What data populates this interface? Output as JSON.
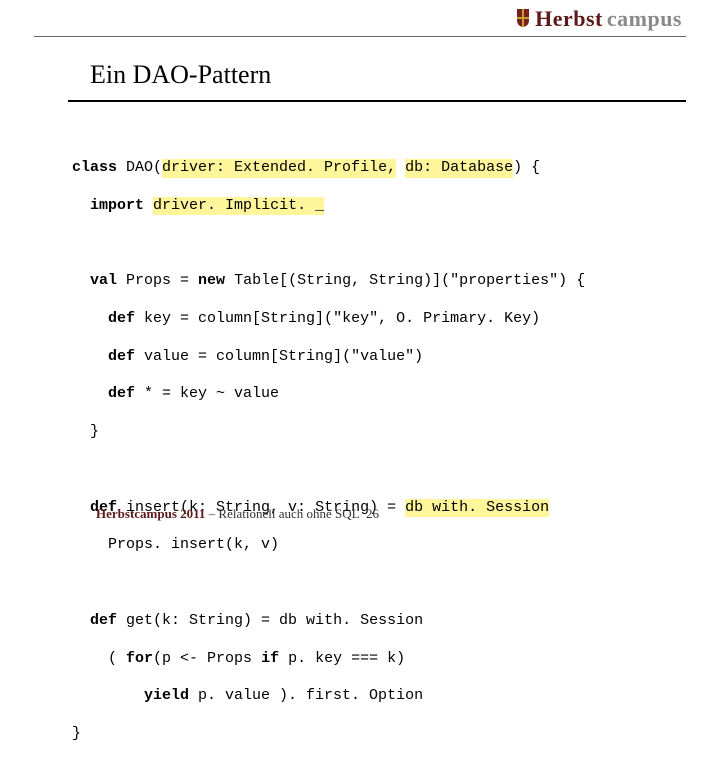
{
  "logo": {
    "part1": "Herbst",
    "part2": "campus"
  },
  "title": "Ein DAO-Pattern",
  "code": {
    "l1_a": "class",
    "l1_b": " DAO(",
    "l1_hl1": "driver: Extended. Profile,",
    "l1_mid": " ",
    "l1_hl2": "db: Database",
    "l1_c": ") {",
    "l2_a": "  ",
    "l2_kw": "import",
    "l2_sp": " ",
    "l2_hl": "driver. Implicit. _",
    "l4_a": "  ",
    "l4_kw1": "val",
    "l4_b": " Props = ",
    "l4_kw2": "new",
    "l4_c": " Table[(String, String)](\"properties\") {",
    "l5_a": "    ",
    "l5_kw": "def",
    "l5_b": " key = column[String](\"key\", O. Primary. Key)",
    "l6_a": "    ",
    "l6_kw": "def",
    "l6_b": " value = column[String](\"value\")",
    "l7_a": "    ",
    "l7_kw": "def",
    "l7_b": " * = key ~ value",
    "l8": "  }",
    "l10_a": "  ",
    "l10_kw": "def",
    "l10_b": " insert(k: String, v: String) = ",
    "l10_hl": "db with. Session",
    "l11": "    Props. insert(k, v)",
    "l13_a": "  ",
    "l13_kw": "def",
    "l13_b": " get(k: String) = db with. Session",
    "l14_a": "    ( ",
    "l14_kw1": "for",
    "l14_b": "(p <- Props ",
    "l14_kw2": "if",
    "l14_c": " p. key === k)",
    "l15_a": "        ",
    "l15_kw": "yield",
    "l15_b": " p. value ). first. Option",
    "l16": "}"
  },
  "footer": {
    "bold": "Herbstcampus 2011",
    "rest": " – Relationell auch ohne SQL",
    "page": "26"
  }
}
